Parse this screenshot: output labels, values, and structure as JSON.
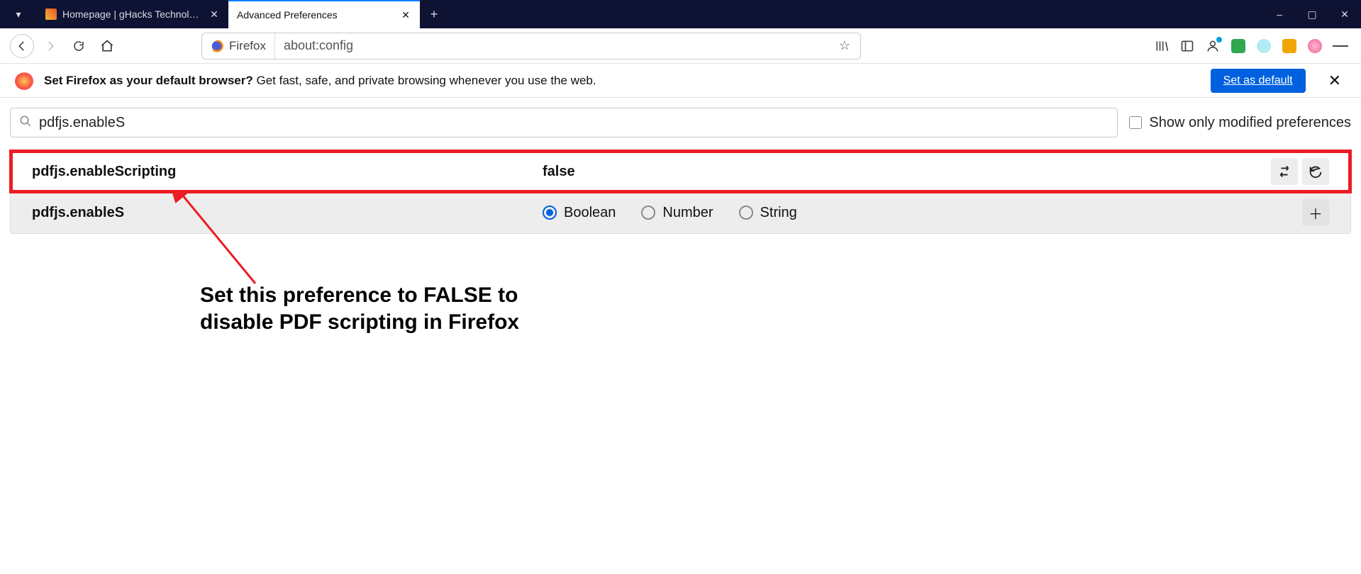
{
  "window": {
    "tabs": [
      {
        "title": "Homepage | gHacks Technology News",
        "active": false
      },
      {
        "title": "Advanced Preferences",
        "active": true
      }
    ],
    "controls": {
      "min": "–",
      "max": "▢",
      "close": "✕"
    },
    "newtab_tooltip": "+"
  },
  "nav": {
    "identity_label": "Firefox",
    "url": "about:config"
  },
  "banner": {
    "bold": "Set Firefox as your default browser?",
    "rest": " Get fast, safe, and private browsing whenever you use the web.",
    "button": "Set as default"
  },
  "config": {
    "search_value": "pdfjs.enableS",
    "show_modified_label": "Show only modified preferences",
    "show_modified_checked": false,
    "rows": [
      {
        "name": "pdfjs.enableScripting",
        "value": "false",
        "kind": "modified"
      },
      {
        "name": "pdfjs.enableS",
        "kind": "new",
        "types": [
          "Boolean",
          "Number",
          "String"
        ],
        "selected_type": "Boolean"
      }
    ]
  },
  "annotation": {
    "text": "Set this preference to FALSE to disable PDF scripting in Firefox"
  }
}
